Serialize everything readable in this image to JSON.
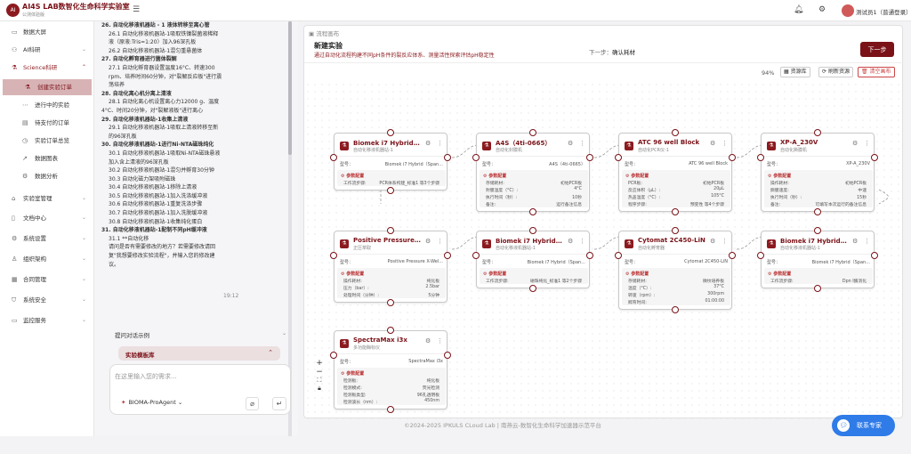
{
  "header": {
    "brand": "AI4S LAB数智化生命科学实验室",
    "brand_sub": "公测体验版",
    "user": "测试员1（普通登录）",
    "avatar_letter": "测"
  },
  "sidebar": {
    "items": [
      {
        "label": "数据大屏",
        "icon": "monitor"
      },
      {
        "label": "AI科研",
        "icon": "ai",
        "chevron": "⌄"
      },
      {
        "label": "Science科研",
        "icon": "flask",
        "chevron": "⌃"
      },
      {
        "label": "创建实验订单",
        "icon": "flask",
        "sub": true
      },
      {
        "label": "进行中的实验",
        "icon": "dots",
        "sub": true
      },
      {
        "label": "待支付的订单",
        "icon": "wallet",
        "sub": true
      },
      {
        "label": "实验订单总览",
        "icon": "clock",
        "sub": true
      },
      {
        "label": "数据图表",
        "icon": "chart",
        "sub": true
      },
      {
        "label": "数据分析",
        "icon": "analysis",
        "sub": true
      },
      {
        "label": "实验室管理",
        "icon": "lab",
        "chevron": "⌄"
      },
      {
        "label": "文档中心",
        "icon": "doc",
        "chevron": "⌄"
      },
      {
        "label": "系统设置",
        "icon": "gear",
        "chevron": "⌄"
      },
      {
        "label": "组织架构",
        "icon": "org",
        "chevron": "⌄"
      },
      {
        "label": "合同管理",
        "icon": "contract",
        "chevron": "⌄"
      },
      {
        "label": "系统安全",
        "icon": "shield",
        "chevron": "⌄"
      },
      {
        "label": "监控服务",
        "icon": "monitor",
        "chevron": "⌄"
      }
    ]
  },
  "chat": {
    "lines": [
      {
        "t": "26. 自动化移液机器站 - 1 液体转移至离心管",
        "b": true
      },
      {
        "t": "26.1 自动化移液机器站-1吸取铁镍裂菌液稀释",
        "b": false
      },
      {
        "t": "液（原液:Tris=1:20）加入96深孔板",
        "b": false
      },
      {
        "t": "26.2 自动化移液机器站-1混匀重悬菌体",
        "b": false
      },
      {
        "t": "27. 自动化孵育器进行菌体裂解",
        "b": true
      },
      {
        "t": "27.1 自动化孵育器设置温度16°C、转速300",
        "b": false
      },
      {
        "t": "rpm、培养时间60分钟，对\"裂解反应板\"进行震",
        "b": false
      },
      {
        "t": "荡培养",
        "b": false
      },
      {
        "t": "28. 自动化离心机分离上清液",
        "b": true
      },
      {
        "t": "28.1 自动化离心机设置离心力12000 g、温度",
        "b": false
      },
      {
        "t": "4°C、时间20分钟，对\"裂解液板\"进行离心",
        "b": false
      },
      {
        "t": "29. 自动化移液机器站-1收集上清液",
        "b": true
      },
      {
        "t": "29.1 自动化移液机器站-1吸取上清液转移至新",
        "b": false
      },
      {
        "t": "的96深孔板",
        "b": false
      },
      {
        "t": "30. 自动化移液机器站-1进行Ni-NTA磁珠纯化",
        "b": true
      },
      {
        "t": "30.1 自动化移液机器站-1吸取Ni-NTA磁珠悬液",
        "b": false
      },
      {
        "t": "加入含上清液的96深孔板",
        "b": false
      },
      {
        "t": "30.2 自动化移液机器站-1混匀并孵育30分钟",
        "b": false
      },
      {
        "t": "30.3 自动化磁力架吸附磁珠",
        "b": false
      },
      {
        "t": "30.4 自动化移液机器站-1移除上清液",
        "b": false
      },
      {
        "t": "30.5 自动化移液机器站-1加入洗涤缓冲液",
        "b": false
      },
      {
        "t": "30.6 自动化移液机器站-1重复洗涤步骤",
        "b": false
      },
      {
        "t": "30.7 自动化移液机器站-1加入洗脱缓冲液",
        "b": false
      },
      {
        "t": "30.8 自动化移液机器站-1收集纯化蛋白",
        "b": false
      },
      {
        "t": "31. 自动化移液机器站-1配制不同pH缓冲液",
        "b": true
      },
      {
        "t": "31.1 **自动化移",
        "b": false
      },
      {
        "t": "请问是否有需要修改的地方？若需要修改请回",
        "b": false
      },
      {
        "t": "复\"我想要修改实验流程\"，并输入您的修改建",
        "b": false
      },
      {
        "t": "议。",
        "b": false
      }
    ],
    "time": "19:12",
    "suggestions": "提问对话示例",
    "library": "实验模板库",
    "placeholder": "在这里输入您的需求...",
    "agent": "BIOMA-ProAgent"
  },
  "canvas": {
    "tab": "流程画布",
    "project_name": "新建实验",
    "project_desc": "通过自动化流程构建不同pH条件的裂反应体系、测量活性探索评估pH稳定性",
    "next_label": "下一步：",
    "next_step": "确认耗材",
    "next_button": "下一步",
    "zoom": "94%",
    "buttons": [
      "资源库",
      "刷新资源",
      "清空画布"
    ],
    "param_title": "参数配置",
    "model_label": "型号：",
    "nodes": [
      {
        "title": "Biomek i7 Hybrid（...",
        "sub": "自动化移液机器站-1",
        "model": "Biomek i7 Hybrid（Span...",
        "params": [
          [
            "工作流步骤:",
            "PCR体系构建_标准1 等3个步骤"
          ]
        ]
      },
      {
        "title": "A4S（4ti-0665）",
        "sub": "自动化封膜机",
        "model": "A4S（4ti-0665）",
        "params": [
          [
            "存储耗材:",
            "初始PCR板"
          ],
          [
            "封膜温度（°C）:",
            "4°C"
          ],
          [
            "执行时间（秒）:",
            "10秒"
          ],
          [
            "备注:",
            "运行备注信息"
          ]
        ]
      },
      {
        "title": "ATC 96 well Block",
        "sub": "自动化PCR仪-1",
        "model": "ATC 96 well Block",
        "params": [
          [
            "PCR板:",
            "初始PCR板"
          ],
          [
            "反应体积（μL）:",
            "20μL"
          ],
          [
            "热盖温度（°C）:",
            "105°C"
          ],
          [
            "程序步骤:",
            "预变性 等4个步骤"
          ]
        ]
      },
      {
        "title": "XP-A_230V",
        "sub": "自动化撕膜机",
        "model": "XP-A_230V",
        "params": [
          [
            "操作耗材:",
            "初始PCR板"
          ],
          [
            "撕膜速度:",
            "中速"
          ],
          [
            "执行时间（秒）:",
            "15秒"
          ],
          [
            "备注:",
            "可填写本次运行的备注信息"
          ]
        ]
      },
      {
        "title": "Positive Pressure X...",
        "sub": "正压萃取",
        "model": "Positive Pressure X-Wel...",
        "params": [
          [
            "操作耗材:",
            "纯化板"
          ],
          [
            "压力（bar）:",
            "2.5bar"
          ],
          [
            "处理时间（分钟）:",
            "5分钟"
          ]
        ]
      },
      {
        "title": "Biomek i7 Hybrid（...",
        "sub": "自动化移液机器站-1",
        "model": "Biomek i7 Hybrid（Span...",
        "params": [
          [
            "工作流步骤:",
            "磁珠纯化_标准1 等2个步骤"
          ]
        ]
      },
      {
        "title": "Cytomat 2C450-LiN",
        "sub": "自动化孵育器",
        "model": "Cytomat 2C450-LiN",
        "params": [
          [
            "存储耗材:",
            "微纹培养板"
          ],
          [
            "温度（°C）:",
            "37°C"
          ],
          [
            "转速（rpm）:",
            "300rpm"
          ],
          [
            "孵育时间:",
            "01:00:00"
          ]
        ]
      },
      {
        "title": "Biomek i7 Hybrid（...",
        "sub": "自动化移液机器站-1",
        "model": "Biomek i7 Hybrid（Span...",
        "params": [
          [
            "工作流步骤:",
            "Dpn I酶消化"
          ]
        ]
      },
      {
        "title": "SpectraMax i3x",
        "sub": "多功能酶标仪",
        "model": "SpectraMax i3x",
        "params": [
          [
            "检测板:",
            "纯化板"
          ],
          [
            "检测模式:",
            "荧光检测"
          ],
          [
            "检测板类型:",
            "96孔透明板"
          ],
          [
            "检测波长（nm）:",
            "450nm"
          ]
        ]
      }
    ]
  },
  "footer": "©2024-2025 IPKULS CLoud Lab | 南燕云-数智化生命科学加速器示范平台",
  "expert": "联系专家"
}
